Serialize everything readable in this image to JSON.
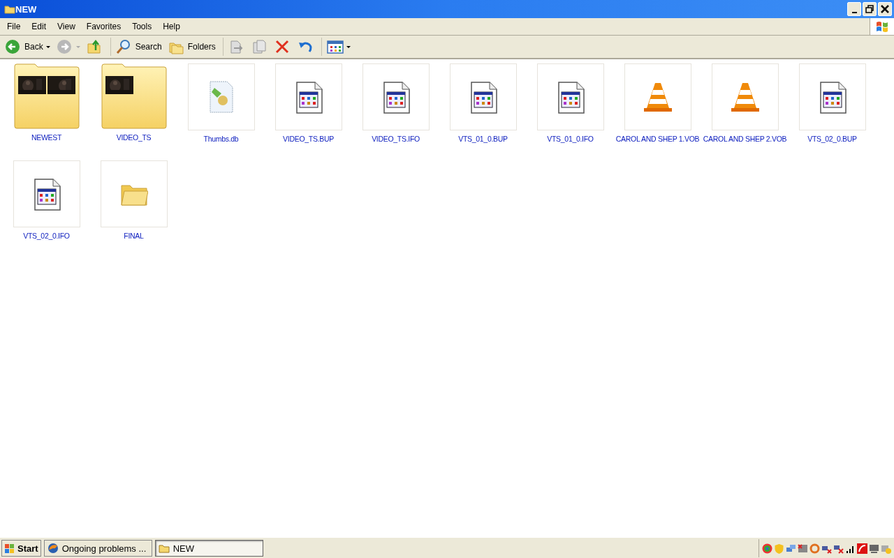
{
  "window": {
    "title": "NEW"
  },
  "menu": [
    "File",
    "Edit",
    "View",
    "Favorites",
    "Tools",
    "Help"
  ],
  "toolbar": [
    {
      "kind": "back",
      "label": "Back",
      "disabled": false
    },
    {
      "kind": "forward",
      "disabled": true
    },
    {
      "kind": "up",
      "disabled": false
    },
    {
      "kind": "search",
      "label": "Search",
      "disabled": false
    },
    {
      "kind": "folders",
      "label": "Folders",
      "disabled": false
    },
    {
      "kind": "move",
      "disabled": true
    },
    {
      "kind": "copy",
      "disabled": true
    },
    {
      "kind": "delete",
      "disabled": false
    },
    {
      "kind": "undo",
      "disabled": false
    },
    {
      "kind": "views",
      "disabled": false
    }
  ],
  "files": [
    {
      "name": "NEWEST",
      "kind": "folder"
    },
    {
      "name": "VIDEO_TS",
      "kind": "folder"
    },
    {
      "name": "Thumbs.db",
      "kind": "database"
    },
    {
      "name": "VIDEO_TS.BUP",
      "kind": "app-file"
    },
    {
      "name": "VIDEO_TS.IFO",
      "kind": "app-file"
    },
    {
      "name": "VTS_01_0.BUP",
      "kind": "app-file"
    },
    {
      "name": "VTS_01_0.IFO",
      "kind": "app-file"
    },
    {
      "name": "CAROL AND SHEP 1.VOB",
      "kind": "cone"
    },
    {
      "name": "CAROL AND SHEP 2.VOB",
      "kind": "cone"
    },
    {
      "name": "VTS_02_0.BUP",
      "kind": "app-file"
    },
    {
      "name": "VTS_02_0.IFO",
      "kind": "app-file"
    },
    {
      "name": "FINAL",
      "kind": "small-folder"
    }
  ],
  "taskbar": {
    "start": "Start",
    "tasks": [
      {
        "label": "Ongoing problems ...",
        "kind": "browser",
        "selected": false
      },
      {
        "label": "NEW",
        "kind": "folder",
        "selected": true
      }
    ]
  }
}
